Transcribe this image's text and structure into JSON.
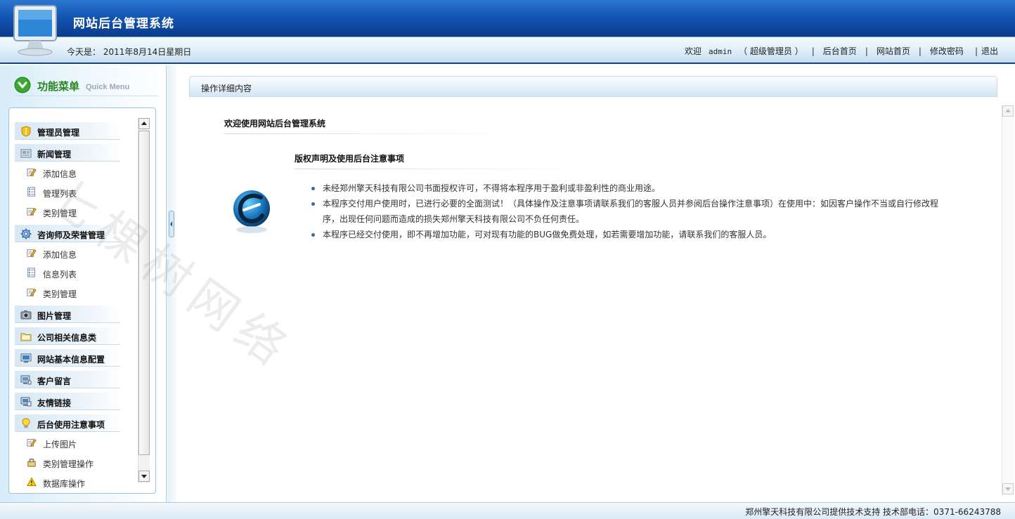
{
  "header": {
    "site_title": "网站后台管理系统",
    "date_label": "今天是：",
    "date_value": "2011年8月14日星期日",
    "welcome": "欢迎",
    "username": "admin",
    "role": "（ 超级管理员 ）",
    "nav": [
      {
        "label": "后台首页"
      },
      {
        "label": "网站首页"
      },
      {
        "label": "修改密码"
      },
      {
        "label": "退出"
      }
    ]
  },
  "sidebar": {
    "menu_title": "功能菜单",
    "menu_subtitle": "Quick Menu",
    "items": [
      {
        "type": "cat",
        "label": "管理员管理",
        "icon": "shield-icon"
      },
      {
        "type": "cat",
        "label": "新闻管理",
        "icon": "newspaper-icon"
      },
      {
        "type": "sub",
        "label": "添加信息",
        "icon": "edit-icon"
      },
      {
        "type": "sub",
        "label": "管理列表",
        "icon": "list-icon"
      },
      {
        "type": "sub",
        "label": "类别管理",
        "icon": "edit-icon"
      },
      {
        "type": "cat",
        "label": "咨询师及荣誉管理",
        "icon": "gear-icon"
      },
      {
        "type": "sub",
        "label": "添加信息",
        "icon": "edit-icon"
      },
      {
        "type": "sub",
        "label": "信息列表",
        "icon": "list-icon"
      },
      {
        "type": "sub",
        "label": "类别管理",
        "icon": "edit-icon"
      },
      {
        "type": "cat",
        "label": "图片管理",
        "icon": "camera-icon"
      },
      {
        "type": "cat",
        "label": "公司相关信息类",
        "icon": "folder-icon"
      },
      {
        "type": "cat",
        "label": "网站基本信息配置",
        "icon": "monitor-icon"
      },
      {
        "type": "cat",
        "label": "客户留言",
        "icon": "chat-icon"
      },
      {
        "type": "cat",
        "label": "友情链接",
        "icon": "link-icon"
      },
      {
        "type": "cat",
        "label": "后台使用注意事项",
        "icon": "bulb-icon"
      },
      {
        "type": "sub",
        "label": "上传图片",
        "icon": "edit-icon"
      },
      {
        "type": "sub",
        "label": "类别管理操作",
        "icon": "lock-icon"
      },
      {
        "type": "sub",
        "label": "数据库操作",
        "icon": "warning-icon"
      }
    ]
  },
  "main": {
    "header_title": "操作详细内容",
    "welcome_title": "欢迎使用网站后台管理系统",
    "notice_title": "版权声明及使用后台注意事项",
    "notes": [
      "未经郑州擎天科技有限公司书面授权许可，不得将本程序用于盈利或非盈利性的商业用途。",
      "本程序交付用户使用时，已进行必要的全面测试！（具体操作及注意事项请联系我们的客服人员并参阅后台操作注意事项）在使用中：如因客户操作不当或自行修改程序，出现任何问题而造成的损失郑州擎天科技有限公司不负任何责任。",
      "本程序已经交付使用，即不再增加功能，可对现有功能的BUG做免费处理，如若需要增加功能，请联系我们的客服人员。"
    ]
  },
  "watermark": "七棵树网络",
  "footer": {
    "text": "郑州擎天科技有限公司提供技术支持 技术部电话：0371-66243788"
  },
  "colors": {
    "header_blue": "#1456b4",
    "menu_green": "#27851f"
  }
}
